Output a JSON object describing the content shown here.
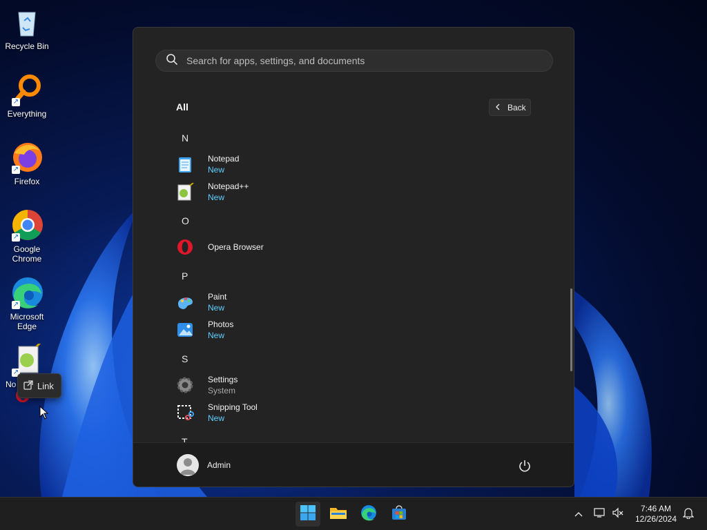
{
  "desktop": {
    "icons": [
      {
        "label": "Recycle Bin",
        "icon": "recycle-bin-icon"
      },
      {
        "label": "Everything",
        "icon": "everything-icon"
      },
      {
        "label": "Firefox",
        "icon": "firefox-icon"
      },
      {
        "label": "Google Chrome",
        "icon": "chrome-icon"
      },
      {
        "label": "Microsoft Edge",
        "icon": "edge-icon"
      },
      {
        "label": "No",
        "icon": "notepad-plus-plus-icon"
      }
    ],
    "tooltip": {
      "label": "Link",
      "icon": "open-link-icon"
    }
  },
  "start_menu": {
    "search": {
      "placeholder": "Search for apps, settings, and documents"
    },
    "section_title": "All",
    "back_label": "Back",
    "letters": [
      "N",
      "O",
      "P",
      "S",
      "T"
    ],
    "apps": [
      {
        "name": "Notepad",
        "sub": "New",
        "icon": "notepad-icon"
      },
      {
        "name": "Notepad++",
        "sub": "New",
        "icon": "notepad-plus-plus-icon"
      },
      {
        "name": "Opera Browser",
        "sub": "",
        "icon": "opera-icon"
      },
      {
        "name": "Paint",
        "sub": "New",
        "icon": "paint-icon"
      },
      {
        "name": "Photos",
        "sub": "New",
        "icon": "photos-icon"
      },
      {
        "name": "Settings",
        "sub": "System",
        "icon": "settings-gear-icon"
      },
      {
        "name": "Snipping Tool",
        "sub": "New",
        "icon": "snipping-tool-icon"
      }
    ],
    "user": {
      "name": "Admin"
    }
  },
  "taskbar": {
    "pinned": [
      "start-icon",
      "file-explorer-icon",
      "edge-icon",
      "store-icon"
    ],
    "clock": {
      "time": "7:46 AM",
      "date": "12/26/2024"
    }
  },
  "colors": {
    "accent": "#60cdff",
    "menu_bg": "#232323",
    "taskbar_bg": "#1f1f1f"
  }
}
